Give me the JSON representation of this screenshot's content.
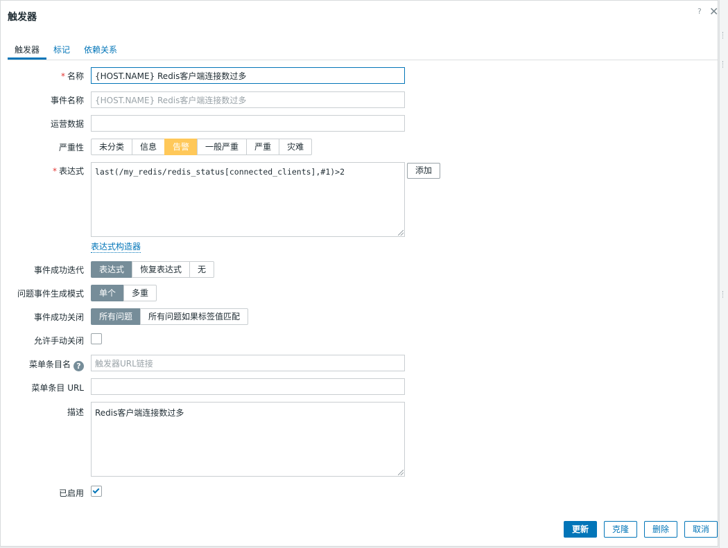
{
  "dialog": {
    "title": "触发器",
    "help": "?",
    "close": "✕"
  },
  "tabs": [
    {
      "label": "触发器"
    },
    {
      "label": "标记"
    },
    {
      "label": "依赖关系"
    }
  ],
  "form": {
    "required_mark": "*",
    "name": {
      "label": "名称",
      "value": "{HOST.NAME} Redis客户端连接数过多"
    },
    "event_name": {
      "label": "事件名称",
      "placeholder": "{HOST.NAME} Redis客户端连接数过多"
    },
    "opdata": {
      "label": "运营数据",
      "value": ""
    },
    "severity": {
      "label": "严重性",
      "options": [
        "未分类",
        "信息",
        "告警",
        "一般严重",
        "严重",
        "灾难"
      ],
      "selected": "告警",
      "selected_color": "#ffc859"
    },
    "expression": {
      "label": "表达式",
      "value": "last(/my_redis/redis_status[connected_clients],#1)>2",
      "add_button": "添加",
      "constructor_link": "表达式构造器"
    },
    "ok_event_generation": {
      "label": "事件成功迭代",
      "options": [
        "表达式",
        "恢复表达式",
        "无"
      ],
      "selected": "表达式"
    },
    "problem_mode": {
      "label": "问题事件生成模式",
      "options": [
        "单个",
        "多重"
      ],
      "selected": "单个"
    },
    "ok_event_closes": {
      "label": "事件成功关闭",
      "options": [
        "所有问题",
        "所有问题如果标签值匹配"
      ],
      "selected": "所有问题"
    },
    "manual_close": {
      "label": "允许手动关闭",
      "checked": false
    },
    "url_name": {
      "label": "菜单条目名",
      "help": "?",
      "placeholder": "触发器URL链接"
    },
    "url": {
      "label": "菜单条目 URL",
      "value": ""
    },
    "description": {
      "label": "描述",
      "value": "Redis客户端连接数过多"
    },
    "enabled": {
      "label": "已启用",
      "checked": true
    }
  },
  "footer": {
    "update": "更新",
    "clone": "克隆",
    "delete": "删除",
    "cancel": "取消"
  },
  "colors": {
    "accent": "#0275b8",
    "selected_grey": "#768d99",
    "warning": "#ffc859",
    "required": "#e33734"
  }
}
